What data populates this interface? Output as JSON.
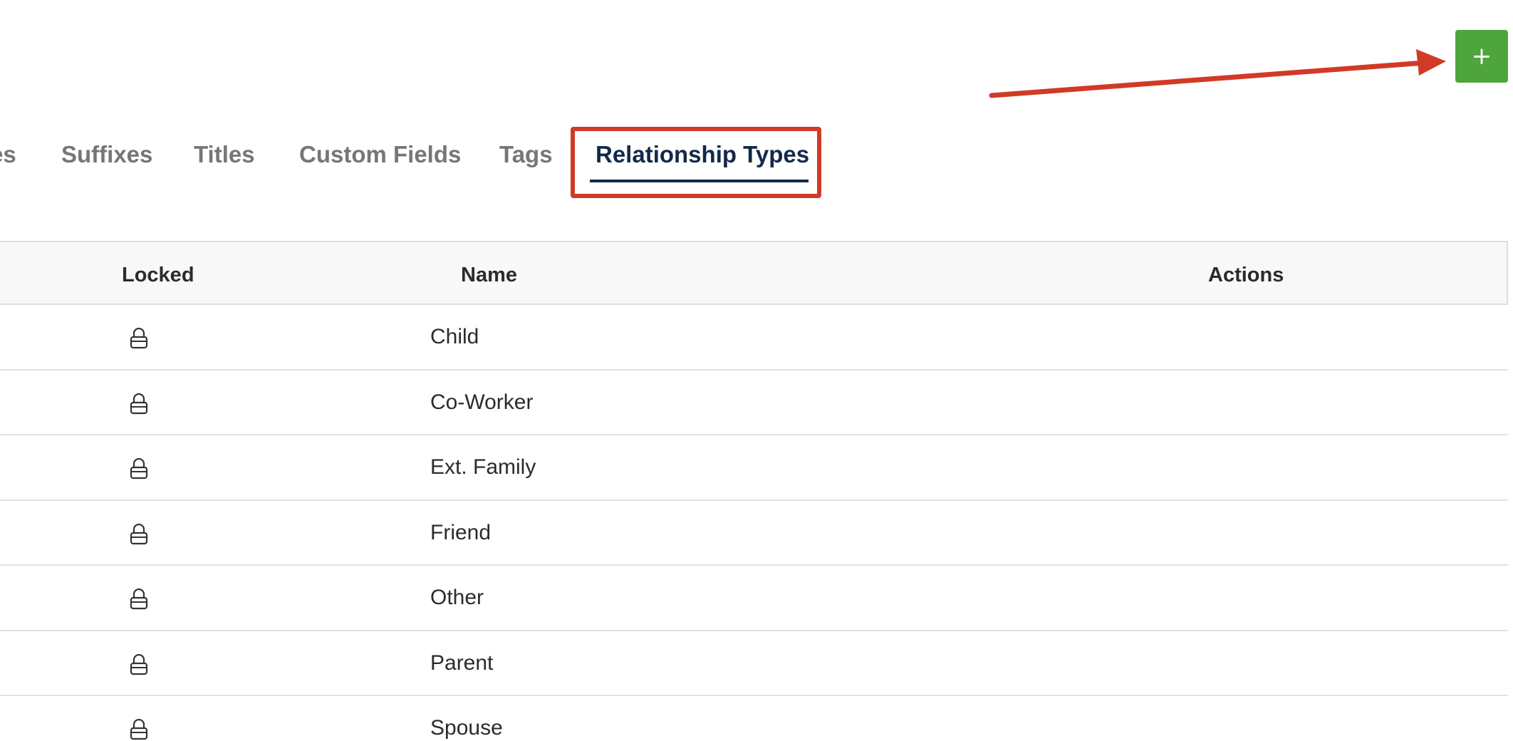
{
  "toolbar": {
    "add_label": "+"
  },
  "tabs": [
    {
      "label": "es"
    },
    {
      "label": "Suffixes"
    },
    {
      "label": "Titles"
    },
    {
      "label": "Custom Fields"
    },
    {
      "label": "Tags"
    },
    {
      "label": "Relationship Types",
      "active": true
    }
  ],
  "table": {
    "columns": [
      "Locked",
      "Name",
      "Actions"
    ],
    "rows": [
      {
        "locked_icon": "lock-icon",
        "name": "Child"
      },
      {
        "locked_icon": "lock-icon",
        "name": "Co-Worker"
      },
      {
        "locked_icon": "lock-icon",
        "name": "Ext. Family"
      },
      {
        "locked_icon": "lock-icon",
        "name": "Friend"
      },
      {
        "locked_icon": "lock-icon",
        "name": "Other"
      },
      {
        "locked_icon": "lock-icon",
        "name": "Parent"
      },
      {
        "locked_icon": "lock-icon",
        "name": "Spouse"
      }
    ]
  },
  "colors": {
    "add_button": "#4ea53c",
    "active_tab": "#13294b",
    "inactive_tab": "#767676",
    "annotation": "#d03a26"
  }
}
